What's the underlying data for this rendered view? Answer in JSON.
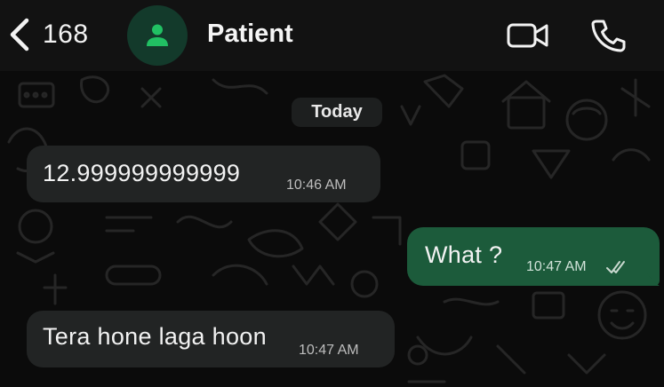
{
  "header": {
    "back_count": "168",
    "contact_name": "Patient"
  },
  "chat": {
    "date_label": "Today",
    "messages": [
      {
        "direction": "incoming",
        "text": "12.999999999999",
        "time": "10:46 AM"
      },
      {
        "direction": "outgoing",
        "text": "What ?",
        "time": "10:47 AM",
        "status": "read"
      },
      {
        "direction": "incoming",
        "text": "Tera hone laga hoon",
        "time": "10:47 AM"
      }
    ]
  },
  "colors": {
    "header_bg": "#121212",
    "chat_bg": "#0b0b0b",
    "incoming_bubble": "#222424",
    "outgoing_bubble": "#1c5b3b",
    "accent_green": "#21c063",
    "avatar_bg": "#133a2b"
  },
  "icons": {
    "back": "chevron-left-icon",
    "avatar": "person-icon",
    "video": "video-camera-icon",
    "call": "phone-icon",
    "read_receipt": "double-check-icon"
  }
}
